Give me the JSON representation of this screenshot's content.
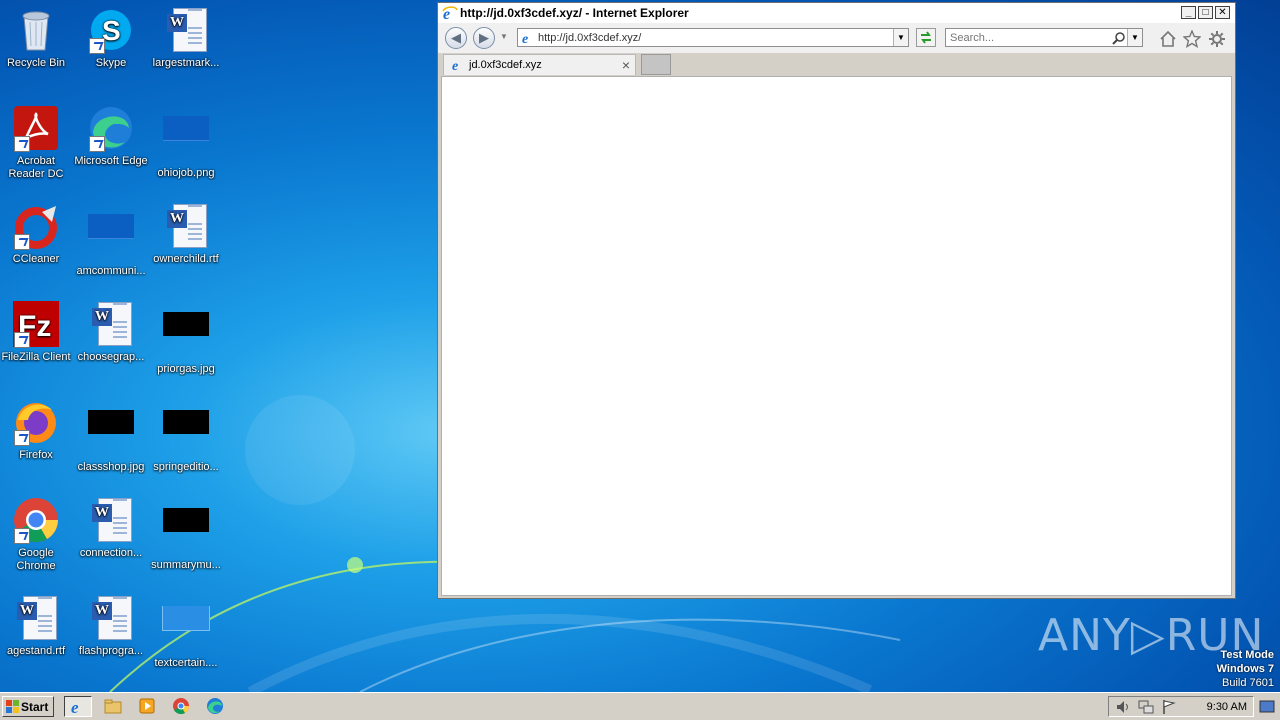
{
  "desktop": {
    "icons": [
      {
        "label": "Recycle Bin"
      },
      {
        "label": "Skype"
      },
      {
        "label": "largestmark..."
      },
      {
        "label": "Acrobat Reader DC"
      },
      {
        "label": "Microsoft Edge"
      },
      {
        "label": "ohiojob.png"
      },
      {
        "label": "CCleaner"
      },
      {
        "label": "amcommuni..."
      },
      {
        "label": "ownerchild.rtf"
      },
      {
        "label": "FileZilla Client"
      },
      {
        "label": "choosegrap..."
      },
      {
        "label": "priorgas.jpg"
      },
      {
        "label": "Firefox"
      },
      {
        "label": "classshop.jpg"
      },
      {
        "label": "springeditio..."
      },
      {
        "label": "Google Chrome"
      },
      {
        "label": "connection..."
      },
      {
        "label": "summarymu..."
      },
      {
        "label": "agestand.rtf"
      },
      {
        "label": "flashprogra..."
      },
      {
        "label": "textcertain...."
      }
    ]
  },
  "browser": {
    "window_title": "http://jd.0xf3cdef.xyz/ - Internet Explorer",
    "address": "http://jd.0xf3cdef.xyz/",
    "search_placeholder": "Search...",
    "tab_title": "jd.0xf3cdef.xyz",
    "close_tab_glyph": "×",
    "min_glyph": "_",
    "max_glyph": "□",
    "close_glyph": "✕"
  },
  "watermark": {
    "text": "ANY▷RUN",
    "test_mode": "Test Mode",
    "os": "Windows 7",
    "build": "Build 7601"
  },
  "taskbar": {
    "start_label": "Start",
    "clock": "9:30 AM"
  }
}
